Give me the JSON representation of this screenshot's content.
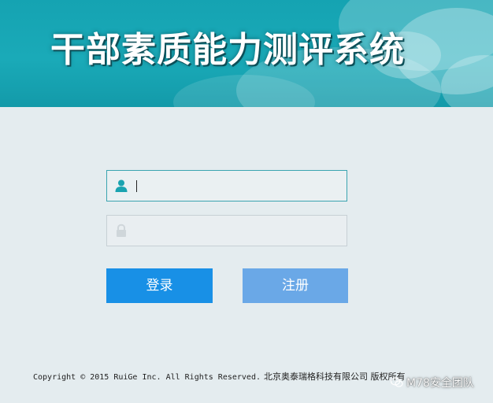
{
  "header": {
    "title": "干部素质能力测评系统"
  },
  "login_form": {
    "username_value": "",
    "password_value": "",
    "login_label": "登录",
    "register_label": "注册"
  },
  "footer": {
    "copyright_en": "Copyright © 2015 RuiGe Inc. All Rights Reserved.",
    "copyright_cn": "北京奥泰瑞格科技有限公司 版权所有"
  },
  "watermark": {
    "text": "M78安全团队"
  },
  "colors": {
    "banner": "#15a3b2",
    "background": "#e4ecef",
    "login_button": "#1890e6",
    "register_button": "#6aa8e7",
    "user_icon": "#1aa3b0",
    "lock_icon": "#cfd6da"
  },
  "icons": {
    "username": "user-icon",
    "password": "lock-icon",
    "watermark": "wechat-icon"
  }
}
